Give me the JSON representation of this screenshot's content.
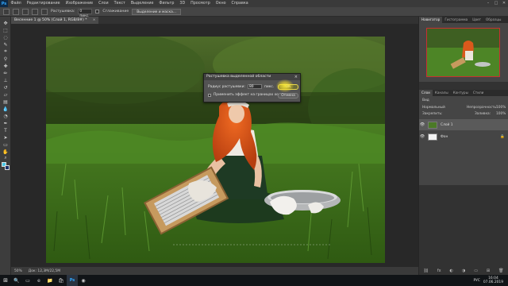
{
  "app": {
    "logo": "Ps"
  },
  "menu": [
    "Файл",
    "Редактирование",
    "Изображение",
    "Слои",
    "Текст",
    "Выделение",
    "Фильтр",
    "3D",
    "Просмотр",
    "Окно",
    "Справка"
  ],
  "window_controls": [
    "–",
    "□",
    "✕"
  ],
  "options": {
    "feather_label": "Растушевка:",
    "feather_value": "0 пикс.",
    "antialias_label": "Сглаживание",
    "select_mask_button": "Выделение и маска..."
  },
  "document_tab": {
    "title": "Весенние 1 @ 50% (Слой 1, RGB/8#) *",
    "close": "×"
  },
  "status": {
    "zoom": "50%",
    "doc_info": "Док: 12,3M/22,5M"
  },
  "dialog": {
    "title": "Растушевка выделенной области",
    "close": "×",
    "radius_label": "Радиус растушевки:",
    "radius_value": "80",
    "radius_unit": "пикс.",
    "apply_label": "Применить эффект на границах холста",
    "ok_label": "ОК",
    "cancel_label": "Отмена"
  },
  "navigator_tabs": [
    "Навигатор",
    "Гистограмма",
    "Цвет",
    "Образцы"
  ],
  "layers_panel": {
    "tabs": [
      "Слои",
      "Каналы",
      "Контуры",
      "Стили"
    ],
    "kind_label": "Вид",
    "blend_mode": "Нормальный",
    "opacity_label": "Непрозрачность:",
    "opacity_value": "100%",
    "lock_label": "Закрепить:",
    "fill_label": "Заливка:",
    "fill_value": "100%",
    "layers": [
      {
        "name": "Слой 1"
      },
      {
        "name": "Фон",
        "lock": "🔒"
      }
    ],
    "footer_icons": [
      "⛓",
      "fx",
      "◐",
      "◑",
      "▭",
      "⊞",
      "🗑"
    ]
  },
  "taskbar": {
    "start": "⊞",
    "apps": [
      "🔍",
      "▭",
      "e",
      "📁",
      "🛍",
      "Ps",
      "◉"
    ],
    "tray_lang": "РУС",
    "time": "16:04",
    "date": "07.06.2019"
  },
  "colors": {
    "foreground": "#4bc8e8",
    "background": "#1b2f6a",
    "ok_border": "#e8d84a",
    "selection_frame": "#c83030"
  },
  "icons": [
    "move-tool-icon",
    "marquee-tool-icon",
    "lasso-tool-icon",
    "quick-select-icon",
    "crop-tool-icon",
    "eyedropper-icon",
    "healing-brush-icon",
    "brush-tool-icon",
    "clone-stamp-icon",
    "history-brush-icon",
    "eraser-icon",
    "gradient-tool-icon",
    "blur-tool-icon",
    "dodge-tool-icon",
    "pen-tool-icon",
    "type-tool-icon",
    "path-select-icon",
    "shape-tool-icon",
    "hand-tool-icon",
    "zoom-tool-icon"
  ]
}
